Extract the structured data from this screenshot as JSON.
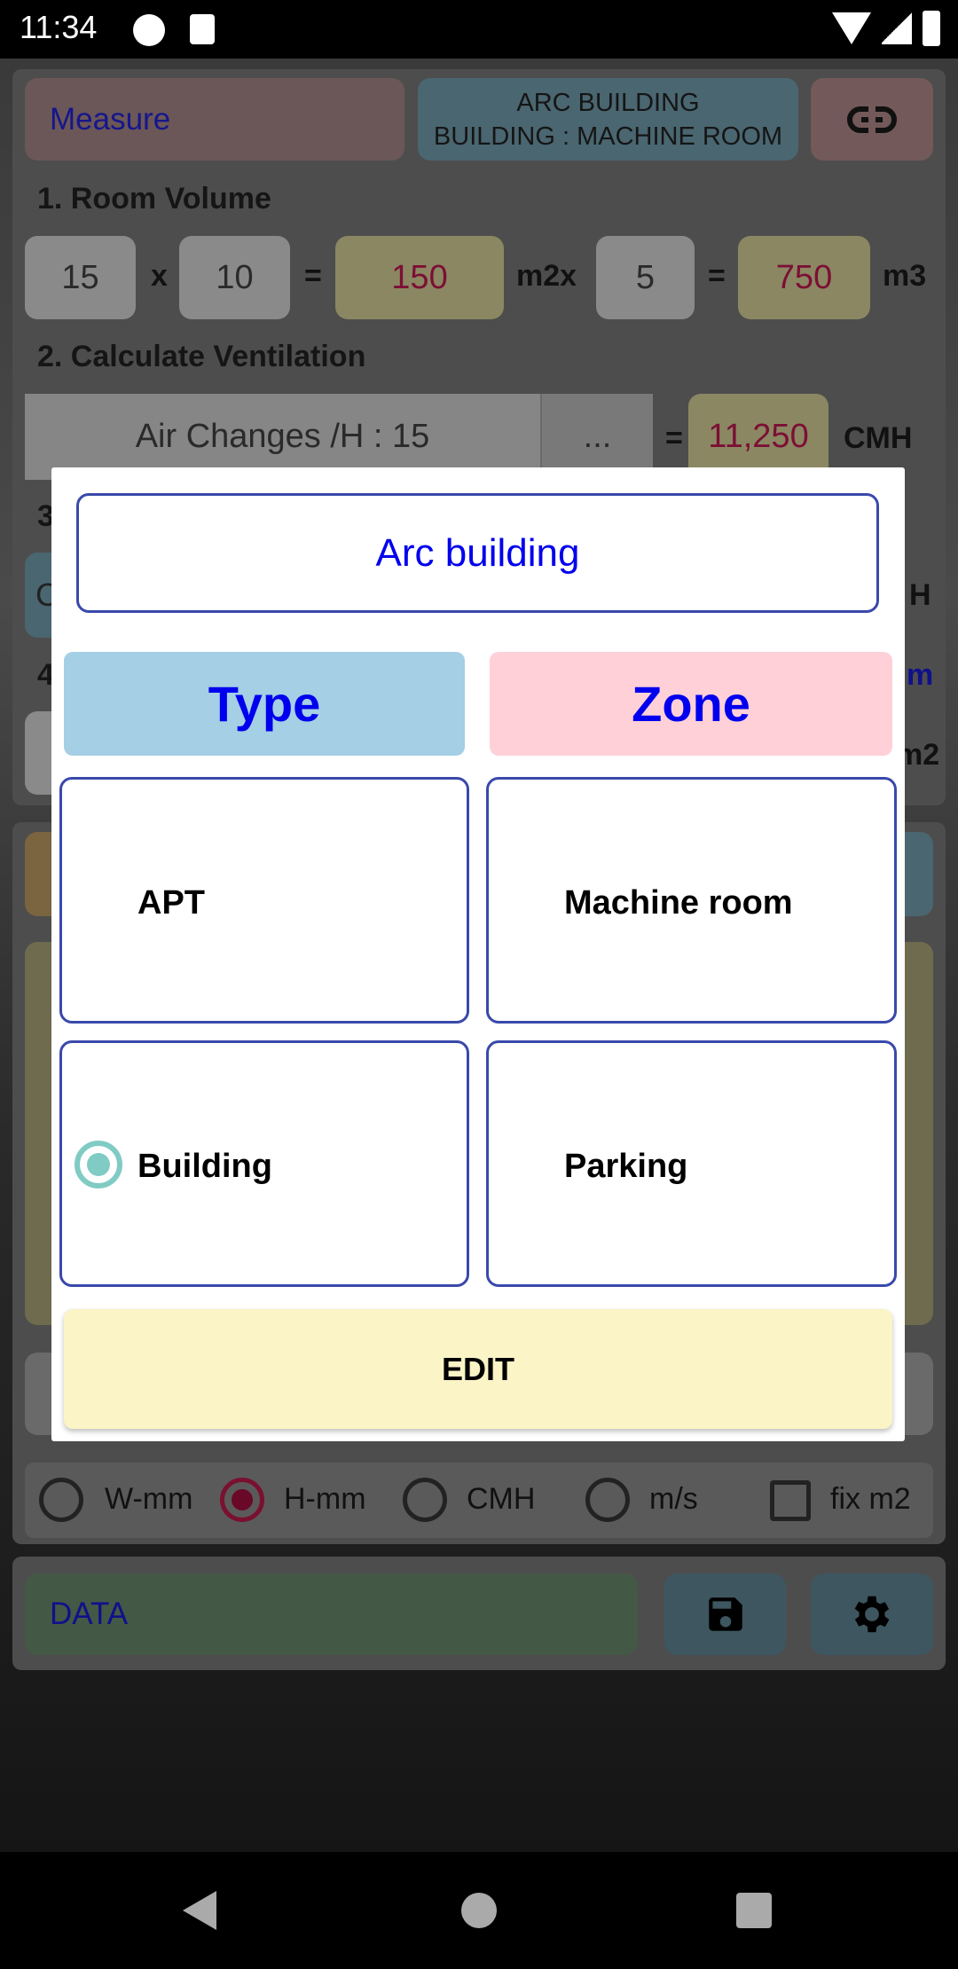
{
  "status_bar": {
    "time": "11:34"
  },
  "header": {
    "measure_label": "Measure",
    "project_line1": "ARC BUILDING",
    "project_line2": "BUILDING : MACHINE ROOM",
    "link_icon": "link-icon"
  },
  "room_volume": {
    "title": "1. Room Volume",
    "width": "15",
    "times": "x",
    "length": "10",
    "eq1": "=",
    "area": "150",
    "area_unit": "m2x",
    "height": "5",
    "eq2": "=",
    "volume": "750",
    "volume_unit": "m3"
  },
  "ventilation": {
    "title": "2. Calculate Ventilation",
    "air_changes": "Air Changes /H : 15",
    "more": "...",
    "eq": "=",
    "flow": "11,250",
    "flow_unit": "CMH"
  },
  "hidden_fragments": {
    "section3": "3",
    "button3": "C",
    "unit3": "H",
    "section4": "4",
    "unit4": "m",
    "unit4b": "m2"
  },
  "options": {
    "items": [
      {
        "label": "W-mm",
        "selected": false
      },
      {
        "label": "H-mm",
        "selected": true
      },
      {
        "label": "CMH",
        "selected": false
      },
      {
        "label": "m/s",
        "selected": false
      }
    ],
    "checkbox_label": "fix m2",
    "checkbox_checked": false
  },
  "footer": {
    "data_label": "DATA",
    "save_icon": "save-icon",
    "settings_icon": "gear-icon"
  },
  "dialog": {
    "name_value": "Arc building",
    "type_header": "Type",
    "zone_header": "Zone",
    "type_options": [
      {
        "label": "APT",
        "selected": false
      },
      {
        "label": "Building",
        "selected": true
      }
    ],
    "zone_options": [
      {
        "label": "Machine room",
        "selected": false
      },
      {
        "label": "Parking",
        "selected": false
      }
    ],
    "edit_label": "EDIT",
    "colors": {
      "type_bg": "#a4cfe4",
      "zone_bg": "#ffd0d8",
      "edit_bg": "#faf4c6",
      "accent": "#0000ee",
      "radio": "#80cbc4"
    }
  }
}
